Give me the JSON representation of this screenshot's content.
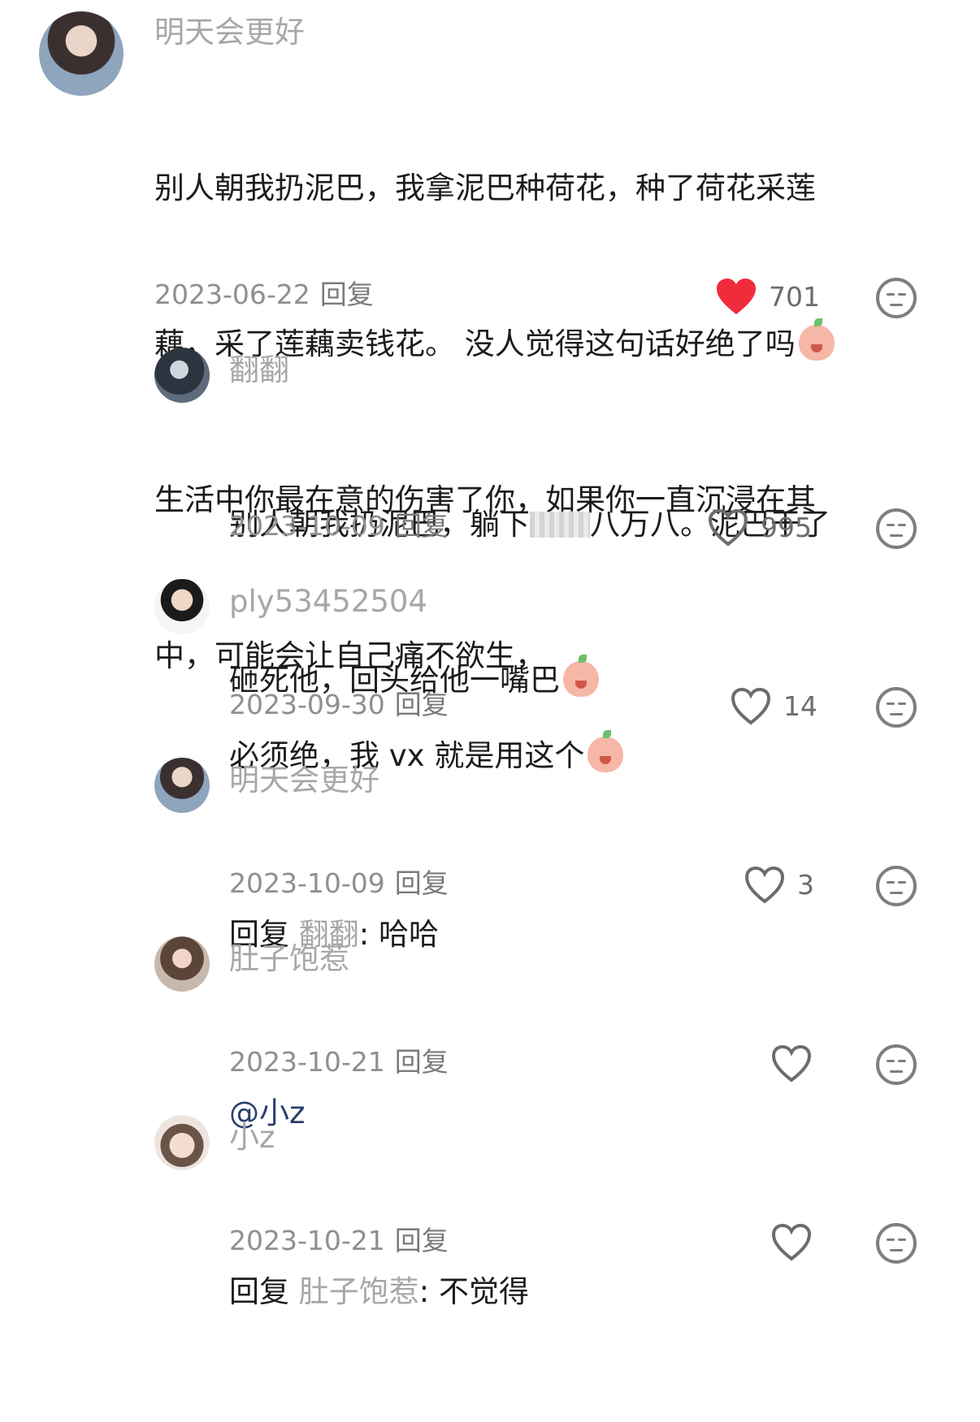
{
  "comments": [
    {
      "username": "明天会更好",
      "text_lines": [
        "别人朝我扔泥巴，我拿泥巴种荷花，种了荷花采莲",
        "藕，采了莲藕卖钱花。 没人觉得这句话好绝了吗",
        "生活中你最在意的伤害了你，如果你一直沉浸在其",
        "中，可能会让自己痛不欲生，"
      ],
      "date": "2023-06-22",
      "reply_label": "回复",
      "likes": "701",
      "liked": true
    },
    {
      "username": "翻翻",
      "text_line1_a": "别人朝我扔泥巴，躺下",
      "text_line1_b": "八万八。泥巴干了",
      "text_line2": "砸死他，回头给他一嘴巴",
      "date": "2023-10-09",
      "reply_label": "回复",
      "likes": "995"
    },
    {
      "username": "ply53452504",
      "text": "必须绝，我 vx 就是用这个",
      "date": "2023-09-30",
      "reply_label": "回复",
      "likes": "14"
    },
    {
      "username": "明天会更好",
      "reply_prefix": "回复",
      "reply_to": "翻翻",
      "reply_text": ": 哈哈",
      "date": "2023-10-09",
      "reply_label": "回复",
      "likes": "3"
    },
    {
      "username": "肚子饱惹",
      "mention": "@小z",
      "date": "2023-10-21",
      "reply_label": "回复",
      "likes": ""
    },
    {
      "username": "小z",
      "reply_prefix": "回复",
      "reply_to": "肚子饱惹",
      "reply_text": ": 不觉得",
      "date": "2023-10-21",
      "reply_label": "回复",
      "likes": ""
    }
  ],
  "colors": {
    "username": "#a7a7a7",
    "text": "#1c1c1c",
    "liked_heart": "#f02b3c",
    "icon_grey": "#7e7e7e",
    "mention": "#2a3f6f"
  },
  "icons": [
    "heart-icon",
    "smiley-icon",
    "emoji-icon"
  ]
}
